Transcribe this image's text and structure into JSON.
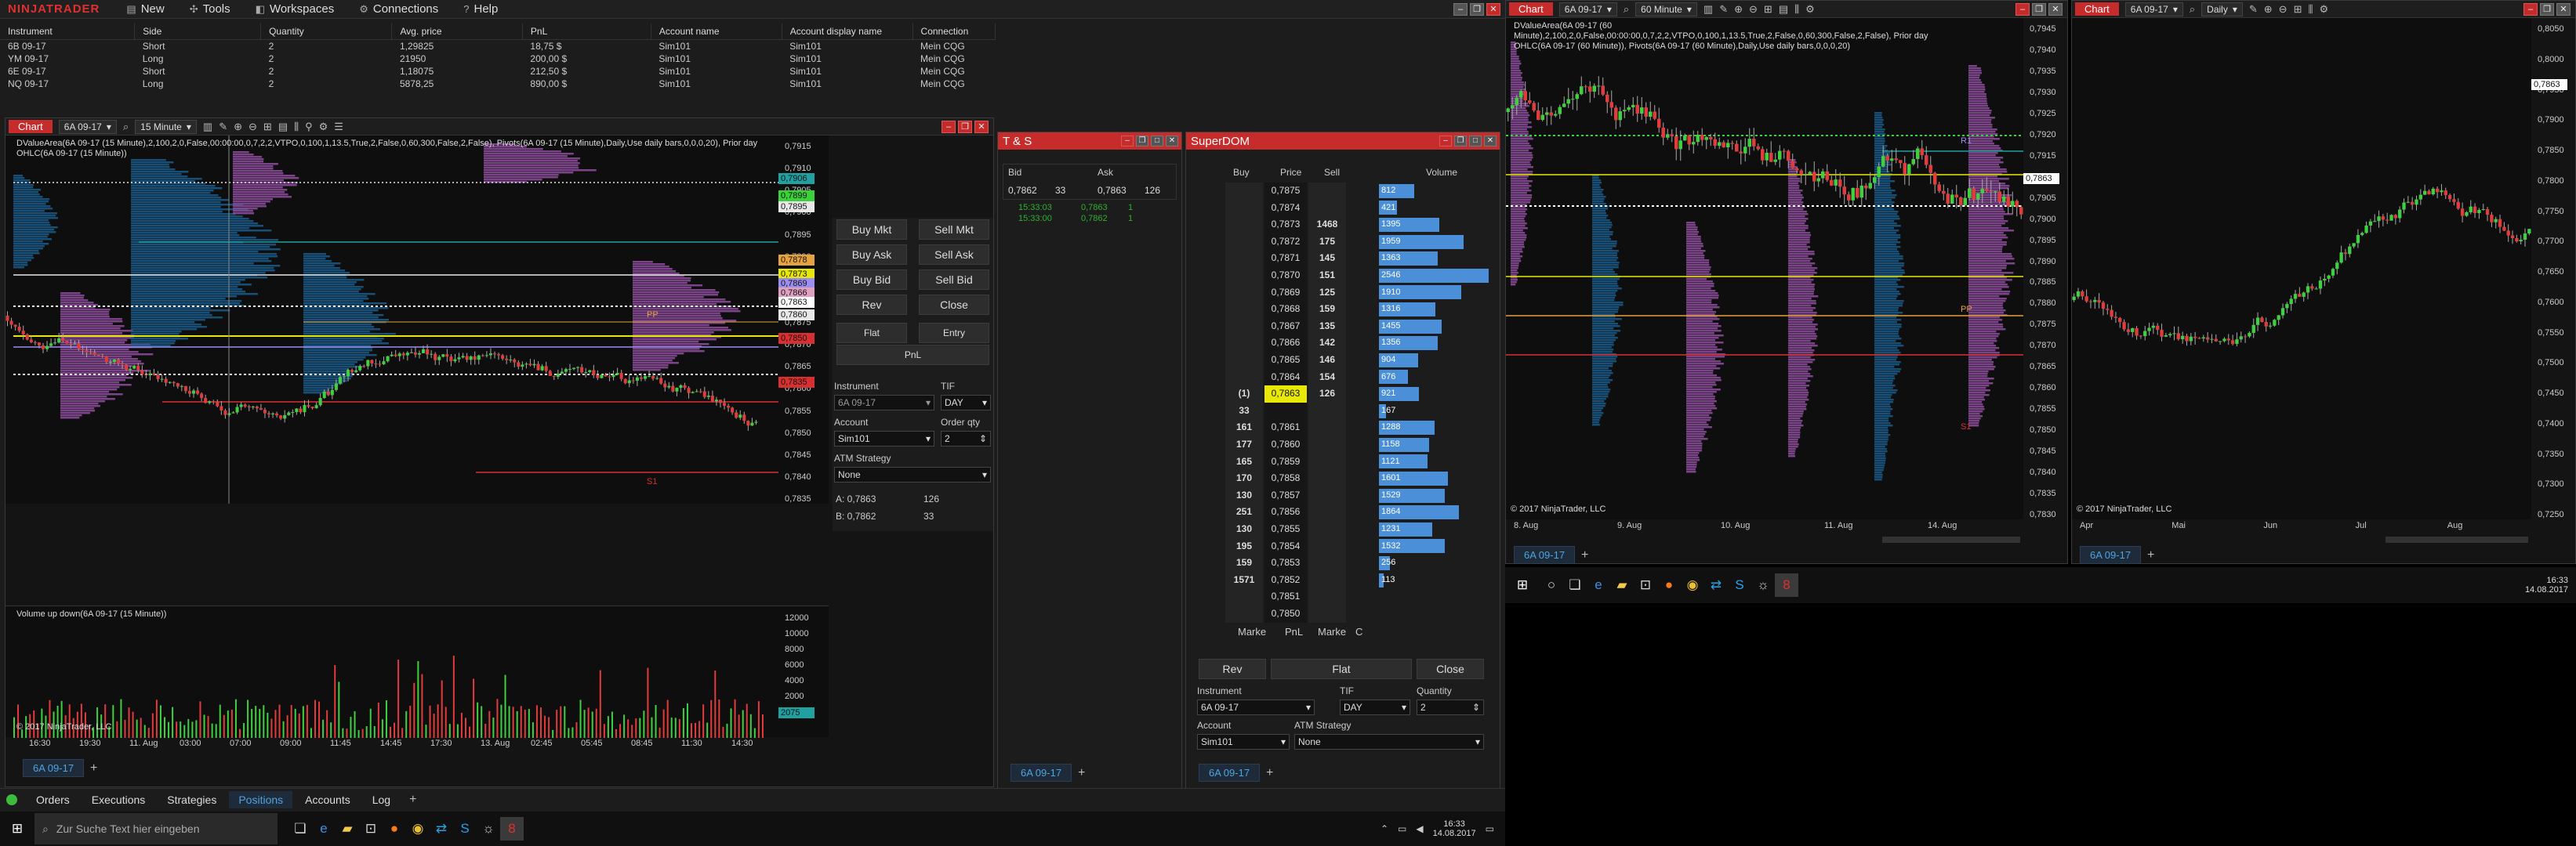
{
  "menubar": {
    "logo": "NINJATRADER",
    "items": [
      {
        "icon": "new-icon",
        "glyph": "▤",
        "label": "New"
      },
      {
        "icon": "tools-icon",
        "glyph": "✣",
        "label": "Tools"
      },
      {
        "icon": "workspaces-icon",
        "glyph": "◧",
        "label": "Workspaces"
      },
      {
        "icon": "connections-icon",
        "glyph": "⚙",
        "label": "Connections"
      },
      {
        "icon": "help-icon",
        "glyph": "?",
        "label": "Help"
      }
    ]
  },
  "positions": {
    "headers": [
      "Instrument",
      "Side",
      "Quantity",
      "Avg. price",
      "PnL",
      "Account name",
      "Account display name",
      "Connection"
    ],
    "rows": [
      [
        "6B 09-17",
        "Short",
        "2",
        "1,29825",
        "18,75 $",
        "Sim101",
        "Sim101",
        "Mein CQG"
      ],
      [
        "YM 09-17",
        "Long",
        "2",
        "21950",
        "200,00 $",
        "Sim101",
        "Sim101",
        "Mein CQG"
      ],
      [
        "6E 09-17",
        "Short",
        "2",
        "1,18075",
        "212,50 $",
        "Sim101",
        "Sim101",
        "Mein CQG"
      ],
      [
        "NQ 09-17",
        "Long",
        "2",
        "5878,25",
        "890,00 $",
        "Sim101",
        "Sim101",
        "Mein CQG"
      ]
    ]
  },
  "chart1": {
    "tab": "Chart",
    "instrument": "6A 09-17",
    "interval": "15 Minute",
    "annotation": "DValueArea(6A 09-17 (15 Minute),2,100,2,0,False,00:00:00,0,7,2,2,VTPO,0,100,1,13.5,True,2,False,0,60,300,False,2,False), Pivots(6A 09-17 (15 Minute),Daily,Use daily bars,0,0,0,20), Prior day OHLC(6A 09-17 (15 Minute))",
    "price_labels": [
      "0,7915",
      "0,7910",
      "0,7905",
      "0,7900",
      "0,7895",
      "0,7890",
      "0,7885",
      "0,7880",
      "0,7875",
      "0,7870",
      "0,7865",
      "0,7860",
      "0,7855",
      "0,7850",
      "0,7845",
      "0,7840",
      "0,7835"
    ],
    "tags": [
      {
        "label": "0,7906",
        "color": "#20a0a0"
      },
      {
        "label": "0,7899",
        "color": "#3ad13a"
      },
      {
        "label": "0,7895",
        "color": "#e8e8e8"
      },
      {
        "label": "0,7878",
        "color": "#e6a23c"
      },
      {
        "label": "0,7873",
        "color": "#e8e800"
      },
      {
        "label": "0,7869",
        "color": "#9b8ef0"
      },
      {
        "label": "0,7866",
        "color": "#e0a0c0"
      },
      {
        "label": "0,7863",
        "color": "#ffffff"
      },
      {
        "label": "0,7860",
        "color": "#e8e8e8"
      },
      {
        "label": "0,7850",
        "color": "#d83030"
      },
      {
        "label": "0,7835",
        "color": "#d83030"
      }
    ],
    "pp_label": "PP",
    "s1_label": "S1",
    "volume_title": "Volume up down(6A 09-17 (15 Minute))",
    "volume_axis": [
      "12000",
      "10000",
      "8000",
      "6000",
      "4000",
      "2000"
    ],
    "volume_tag": "2075",
    "copyright": "© 2017 NinjaTrader, LLC",
    "time_labels": [
      "16:30",
      "19:30",
      "11. Aug",
      "03:00",
      "07:00",
      "09:00",
      "11:45",
      "14:45",
      "17:30",
      "13. Aug",
      "02:45",
      "05:45",
      "08:45",
      "11:30",
      "14:30"
    ],
    "bottom_tab": "6A 09-17"
  },
  "chart_trader": {
    "buttons": [
      "Buy Mkt",
      "Sell Mkt",
      "Buy Ask",
      "Sell Ask",
      "Buy Bid",
      "Sell Bid",
      "Rev",
      "Close"
    ],
    "flat": "Flat",
    "entry": "Entry",
    "pnl": "PnL",
    "instrument_label": "Instrument",
    "instrument_value": "6A 09-17",
    "tif_label": "TIF",
    "tif_value": "DAY",
    "account_label": "Account",
    "account_value": "Sim101",
    "order_qty_label": "Order qty",
    "order_qty_value": "2",
    "atm_label": "ATM Strategy",
    "atm_value": "None",
    "ask_line": "A:  0,7863",
    "ask_size": "126",
    "bid_line": "B:  0,7862",
    "bid_size": "33"
  },
  "ts": {
    "title": "T & S",
    "bid_label": "Bid",
    "ask_label": "Ask",
    "bid_price": "0,7862",
    "bid_size": "33",
    "ask_price": "0,7863",
    "ask_size": "126",
    "trades": [
      {
        "time": "15:33:03",
        "price": "0,7863",
        "size": "1"
      },
      {
        "time": "15:33:00",
        "price": "0,7862",
        "size": "1"
      }
    ],
    "bottom_tab": "6A 09-17"
  },
  "superdom": {
    "title": "SuperDOM",
    "headers": [
      "Buy",
      "Price",
      "Sell",
      "Volume"
    ],
    "rows": [
      {
        "buy": "",
        "price": "0,7875",
        "sell": "",
        "vol": "812",
        "v": 812
      },
      {
        "buy": "",
        "price": "0,7874",
        "sell": "",
        "vol": "421",
        "v": 421
      },
      {
        "buy": "",
        "price": "0,7873",
        "sell": "1468",
        "vol": "1395",
        "v": 1395
      },
      {
        "buy": "",
        "price": "0,7872",
        "sell": "175",
        "vol": "1959",
        "v": 1959
      },
      {
        "buy": "",
        "price": "0,7871",
        "sell": "145",
        "vol": "1363",
        "v": 1363
      },
      {
        "buy": "",
        "price": "0,7870",
        "sell": "151",
        "vol": "2546",
        "v": 2546
      },
      {
        "buy": "",
        "price": "0,7869",
        "sell": "125",
        "vol": "1910",
        "v": 1910
      },
      {
        "buy": "",
        "price": "0,7868",
        "sell": "159",
        "vol": "1316",
        "v": 1316
      },
      {
        "buy": "",
        "price": "0,7867",
        "sell": "135",
        "vol": "1455",
        "v": 1455
      },
      {
        "buy": "",
        "price": "0,7866",
        "sell": "142",
        "vol": "1356",
        "v": 1356
      },
      {
        "buy": "",
        "price": "0,7865",
        "sell": "146",
        "vol": "904",
        "v": 904
      },
      {
        "buy": "",
        "price": "0,7864",
        "sell": "154",
        "vol": "676",
        "v": 676
      },
      {
        "buy": "(1)",
        "price": "0,7863",
        "sell": "126",
        "vol": "921",
        "v": 921,
        "current": true
      },
      {
        "buy": "33",
        "price": "",
        "sell": "",
        "vol": "167",
        "v": 167
      },
      {
        "buy": "161",
        "price": "0,7861",
        "sell": "",
        "vol": "1288",
        "v": 1288
      },
      {
        "buy": "177",
        "price": "0,7860",
        "sell": "",
        "vol": "1158",
        "v": 1158
      },
      {
        "buy": "165",
        "price": "0,7859",
        "sell": "",
        "vol": "1121",
        "v": 1121
      },
      {
        "buy": "170",
        "price": "0,7858",
        "sell": "",
        "vol": "1601",
        "v": 1601
      },
      {
        "buy": "130",
        "price": "0,7857",
        "sell": "",
        "vol": "1529",
        "v": 1529
      },
      {
        "buy": "251",
        "price": "0,7856",
        "sell": "",
        "vol": "1864",
        "v": 1864
      },
      {
        "buy": "130",
        "price": "0,7855",
        "sell": "",
        "vol": "1231",
        "v": 1231
      },
      {
        "buy": "195",
        "price": "0,7854",
        "sell": "",
        "vol": "1532",
        "v": 1532
      },
      {
        "buy": "159",
        "price": "0,7853",
        "sell": "",
        "vol": "256",
        "v": 256
      },
      {
        "buy": "1571",
        "price": "0,7852",
        "sell": "",
        "vol": "113",
        "v": 113
      },
      {
        "buy": "",
        "price": "0,7851",
        "sell": "",
        "vol": "",
        "v": 0
      },
      {
        "buy": "",
        "price": "0,7850",
        "sell": "",
        "vol": "",
        "v": 0
      }
    ],
    "footer": [
      "Marke",
      "PnL",
      "Marke",
      "C"
    ],
    "rev": "Rev",
    "flat": "Flat",
    "close": "Close",
    "instrument_label": "Instrument",
    "instrument_value": "6A 09-17",
    "tif_label": "TIF",
    "tif_value": "DAY",
    "quantity_label": "Quantity",
    "quantity_value": "2",
    "account_label": "Account",
    "account_value": "Sim101",
    "atm_label": "ATM Strategy",
    "atm_value": "None",
    "bottom_tab": "6A 09-17"
  },
  "chart2": {
    "tab": "Chart",
    "instrument": "6A 09-17",
    "interval": "60 Minute",
    "annotation": "DValueArea(6A 09-17 (60 Minute),2,100,2,0,False,00:00:00,0,7,2,2,VTPO,0,100,1,13.5,True,2,False,0,60,300,False,2,False), Prior day OHLC(6A 09-17 (60 Minute)), Pivots(6A 09-17 (60 Minute),Daily,Use daily bars,0,0,0,20)",
    "price_labels": [
      "0,7945",
      "0,7940",
      "0,7935",
      "0,7930",
      "0,7925",
      "0,7920",
      "0,7915",
      "0,7910",
      "0,7905",
      "0,7900",
      "0,7895",
      "0,7890",
      "0,7885",
      "0,7880",
      "0,7875",
      "0,7870",
      "0,7865",
      "0,7860",
      "0,7855",
      "0,7850",
      "0,7845",
      "0,7840",
      "0,7835",
      "0,7830"
    ],
    "current_tag": "0,7863",
    "r1_label": "R1",
    "pp_label": "PP",
    "s1_label": "S1",
    "time_labels": [
      "8. Aug",
      "9. Aug",
      "10. Aug",
      "11. Aug",
      "14. Aug"
    ],
    "copyright": "© 2017 NinjaTrader, LLC",
    "bottom_tab": "6A 09-17"
  },
  "chart3": {
    "tab": "Chart",
    "instrument": "6A 09-17",
    "interval": "Daily",
    "price_labels": [
      "0,8050",
      "0,8000",
      "0,7950",
      "0,7900",
      "0,7850",
      "0,7800",
      "0,7750",
      "0,7700",
      "0,7650",
      "0,7600",
      "0,7550",
      "0,7500",
      "0,7450",
      "0,7400",
      "0,7350",
      "0,7300",
      "0,7250"
    ],
    "current_tag": "0,7863",
    "time_labels": [
      "Apr",
      "Mai",
      "Jun",
      "Jul",
      "Aug"
    ],
    "copyright": "© 2017 NinjaTrader, LLC",
    "bottom_tab": "6A 09-17"
  },
  "control_center_tabs": [
    "Orders",
    "Executions",
    "Strategies",
    "Positions",
    "Accounts",
    "Log"
  ],
  "active_cc_tab": "Positions",
  "taskbar_left": {
    "search_placeholder": "Zur Suche Text hier eingeben",
    "time": "16:33",
    "date": "14.08.2017"
  },
  "taskbar_right": {
    "time": "16:33",
    "date": "14.08.2017"
  },
  "colors": {
    "accent_red": "#c62c2c",
    "profit_green": "#2fb12f",
    "bar_blue": "#4a8fd8",
    "value_area_blue": "#1a4f7a",
    "value_area_purple": "#8e4e9e"
  }
}
